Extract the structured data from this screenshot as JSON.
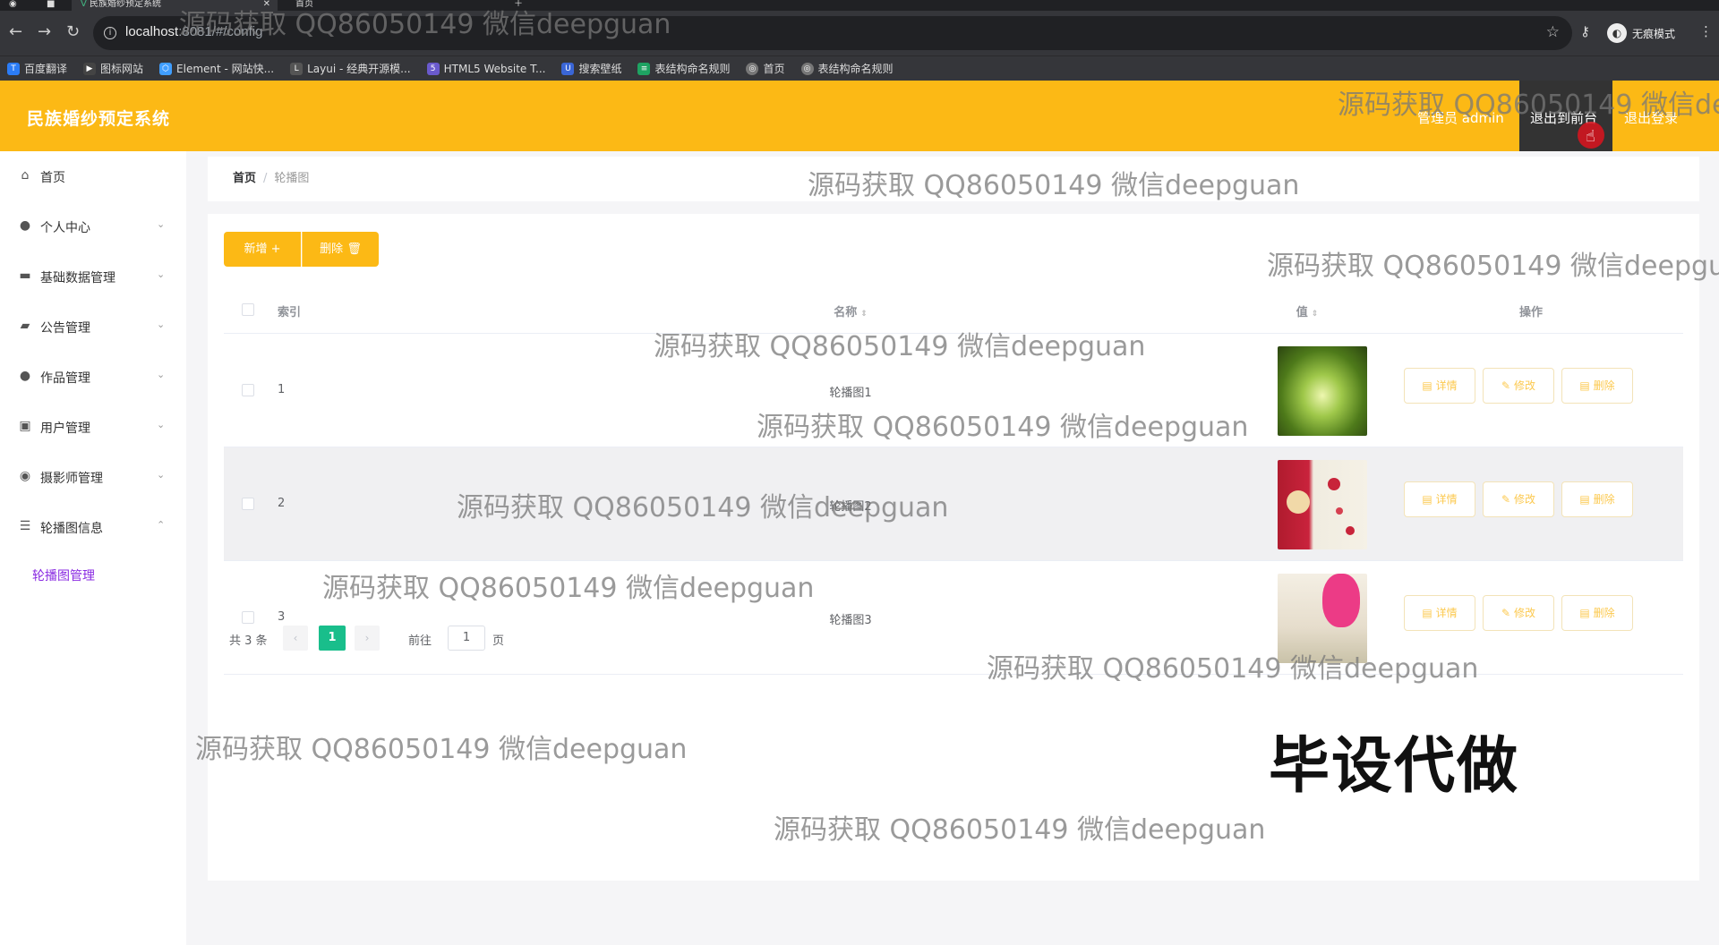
{
  "browser": {
    "tabs": [
      {
        "title": "民族婚纱预定系统",
        "active": true
      },
      {
        "title": "首页",
        "active": false
      }
    ],
    "url_host": "localhost",
    "url_rest": ":8081/#/config",
    "profile_label": "无痕模式",
    "bookmarks": [
      {
        "label": "百度翻译",
        "color": "#2b7cf6"
      },
      {
        "label": "图标网站",
        "color": "#333333"
      },
      {
        "label": "Element - 网站快...",
        "color": "#409eff"
      },
      {
        "label": "Layui - 经典开源模...",
        "color": "#555555"
      },
      {
        "label": "HTML5 Website T...",
        "color": "#6a5acd"
      },
      {
        "label": "搜索壁纸",
        "color": "#3a66d6"
      },
      {
        "label": "表结构命名规则",
        "color": "#1ea362"
      },
      {
        "label": "首页",
        "color": "#777777"
      },
      {
        "label": "表结构命名规则",
        "color": "#777777"
      }
    ]
  },
  "header": {
    "title": "民族婚纱预定系统",
    "admin_label": "管理员 admin",
    "to_front": "退出到前台",
    "logout": "退出登录",
    "accent": "#fcb915"
  },
  "sidebar": {
    "items": [
      {
        "label": "首页",
        "icon": "home-icon"
      },
      {
        "label": "个人中心",
        "icon": "user-icon"
      },
      {
        "label": "基础数据管理",
        "icon": "data-icon"
      },
      {
        "label": "公告管理",
        "icon": "notice-icon"
      },
      {
        "label": "作品管理",
        "icon": "user-icon"
      },
      {
        "label": "用户管理",
        "icon": "edit-icon"
      },
      {
        "label": "摄影师管理",
        "icon": "camera-icon"
      },
      {
        "label": "轮播图信息",
        "icon": "list-icon"
      }
    ],
    "subitem": "轮播图管理"
  },
  "breadcrumb": {
    "home": "首页",
    "current": "轮播图"
  },
  "toolbar": {
    "add": "新增",
    "delete": "删除"
  },
  "table": {
    "headers": {
      "index": "索引",
      "name": "名称",
      "value": "值",
      "ops": "操作"
    },
    "rows": [
      {
        "index": "1",
        "name": "轮播图1"
      },
      {
        "index": "2",
        "name": "轮播图2"
      },
      {
        "index": "3",
        "name": "轮播图3"
      }
    ],
    "ops": {
      "detail": "详情",
      "edit": "修改",
      "delete": "删除"
    }
  },
  "pagination": {
    "total": "共 3 条",
    "current": "1",
    "goto": "前往",
    "input": "1",
    "page": "页"
  },
  "watermark": "源码获取 QQ86050149 微信deepguan",
  "watermark_big": "毕设代做"
}
